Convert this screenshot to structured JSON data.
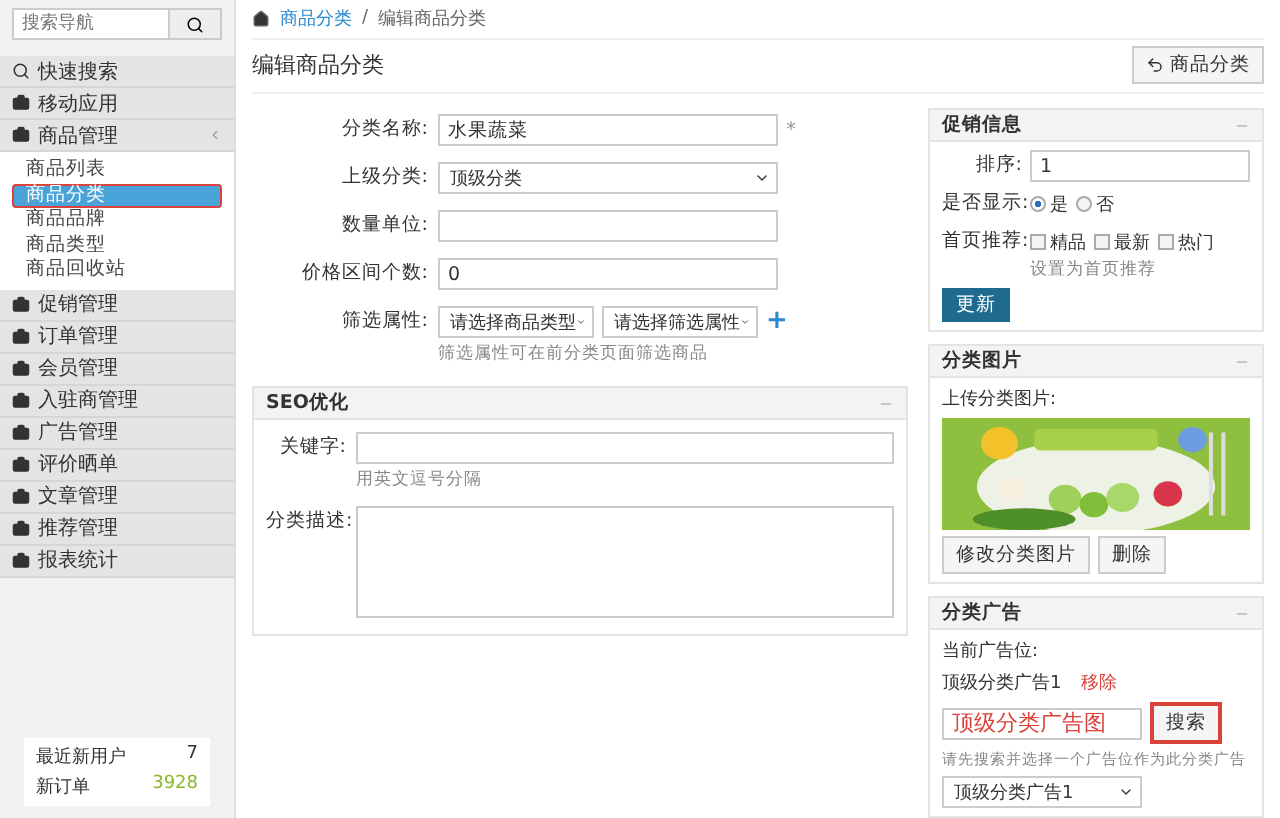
{
  "sidebar": {
    "search": {
      "placeholder": "搜索导航"
    },
    "quick_search": "快速搜索",
    "menu": [
      {
        "label": "移动应用",
        "expanded": false
      },
      {
        "label": "商品管理",
        "expanded": true,
        "children": [
          {
            "label": "商品列表",
            "selected": false,
            "highlighted": false
          },
          {
            "label": "商品分类",
            "selected": true,
            "highlighted": true
          },
          {
            "label": "商品品牌",
            "selected": false,
            "highlighted": false
          },
          {
            "label": "商品类型",
            "selected": false,
            "highlighted": false
          },
          {
            "label": "商品回收站",
            "selected": false,
            "highlighted": false
          }
        ]
      },
      {
        "label": "促销管理",
        "expanded": false
      },
      {
        "label": "订单管理",
        "expanded": false
      },
      {
        "label": "会员管理",
        "expanded": false
      },
      {
        "label": "入驻商管理",
        "expanded": false
      },
      {
        "label": "广告管理",
        "expanded": false
      },
      {
        "label": "评价晒单",
        "expanded": false
      },
      {
        "label": "文章管理",
        "expanded": false
      },
      {
        "label": "推荐管理",
        "expanded": false
      },
      {
        "label": "报表统计",
        "expanded": false
      }
    ],
    "stats": [
      {
        "label": "最近新用户",
        "value": "7",
        "color": "#333333"
      },
      {
        "label": "新订单",
        "value": "3928",
        "color": "#8ab82a"
      }
    ]
  },
  "breadcrumb": {
    "items": [
      "商品分类",
      "编辑商品分类"
    ],
    "separator": "/"
  },
  "page_title": "编辑商品分类",
  "back_button": "商品分类",
  "form": {
    "rows": [
      {
        "kind": "text",
        "label": "分类名称:",
        "value": "水果蔬菜",
        "required_mark": "*"
      },
      {
        "kind": "select",
        "label": "上级分类:",
        "value": "顶级分类"
      },
      {
        "kind": "text",
        "label": "数量单位:"
      },
      {
        "kind": "text",
        "label": "价格区间个数:",
        "value": "0"
      },
      {
        "kind": "filter",
        "label": "筛选属性:",
        "selects": [
          "请选择商品类型",
          "请选择筛选属性"
        ],
        "add": "+",
        "hint": "筛选属性可在前分类页面筛选商品"
      }
    ]
  },
  "seo": {
    "title": "SEO优化",
    "rows": [
      {
        "kind": "text",
        "label": "关键字:",
        "hint": "用英文逗号分隔"
      },
      {
        "kind": "textarea",
        "label": "分类描述:"
      }
    ]
  },
  "promo": {
    "title": "促销信息",
    "sort": {
      "label": "排序:",
      "value": "1"
    },
    "show": {
      "label": "是否显示:",
      "options": [
        {
          "label": "是",
          "selected": true
        },
        {
          "label": "否",
          "selected": false
        }
      ]
    },
    "home": {
      "label": "首页推荐:",
      "options": [
        {
          "label": "精品",
          "checked": false
        },
        {
          "label": "最新",
          "checked": false
        },
        {
          "label": "热门",
          "checked": false
        }
      ],
      "hint": "设置为首页推荐"
    },
    "update_button": "更新"
  },
  "category_image": {
    "title": "分类图片",
    "upload_label": "上传分类图片:",
    "image": {
      "kind": "picture"
    },
    "buttons": [
      "修改分类图片",
      "删除"
    ]
  },
  "category_ad": {
    "title": "分类广告",
    "current_label": "当前广告位:",
    "current_value": "顶级分类广告1",
    "remove_link": "移除",
    "search_value": "顶级分类广告图",
    "search_button": {
      "label": "搜索",
      "highlighted": true
    },
    "hint": "请先搜索并选择一个广告位作为此分类广告",
    "select_value": "顶级分类广告1"
  }
}
